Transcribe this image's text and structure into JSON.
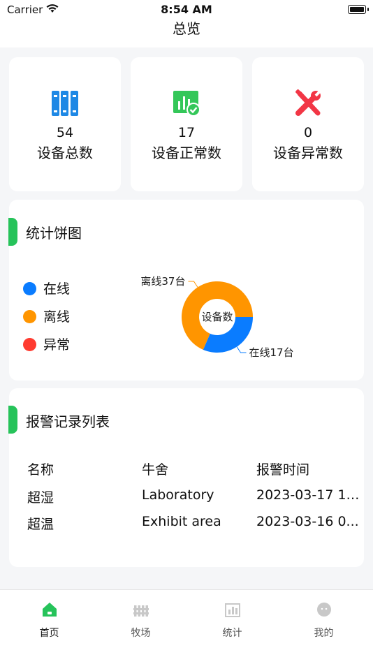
{
  "status_bar": {
    "carrier": "Carrier",
    "time": "8:54 AM"
  },
  "nav": {
    "title": "总览"
  },
  "stats": [
    {
      "value": "54",
      "label": "设备总数",
      "icon": "device-rack-icon",
      "color": "#1e88e5"
    },
    {
      "value": "17",
      "label": "设备正常数",
      "icon": "chart-check-icon",
      "color": "#34c759"
    },
    {
      "value": "0",
      "label": "设备异常数",
      "icon": "wrench-tools-icon",
      "color": "#f23645"
    }
  ],
  "pie_section": {
    "title": "统计饼图"
  },
  "chart_data": {
    "type": "pie",
    "center_label": "设备数",
    "legend": [
      {
        "name": "在线",
        "color": "#0a7cff"
      },
      {
        "name": "离线",
        "color": "#ff9500"
      },
      {
        "name": "异常",
        "color": "#ff3b30"
      }
    ],
    "slices": [
      {
        "name": "在线",
        "value": 17,
        "color": "#0a7cff",
        "label": "在线17台"
      },
      {
        "name": "离线",
        "value": 37,
        "color": "#ff9500",
        "label": "离线37台"
      },
      {
        "name": "异常",
        "value": 0,
        "color": "#ff3b30"
      }
    ]
  },
  "alarm_section": {
    "title": "报警记录列表",
    "headers": [
      "名称",
      "牛舍",
      "报警时间"
    ],
    "rows": [
      [
        "超湿",
        "Laboratory",
        "2023-03-17 11..."
      ],
      [
        "超温",
        "Exhibit area",
        "2023-03-16 0..."
      ]
    ]
  },
  "tabs": [
    {
      "label": "首页",
      "icon": "home-icon",
      "active": true
    },
    {
      "label": "牧场",
      "icon": "fence-icon",
      "active": false
    },
    {
      "label": "统计",
      "icon": "bar-chart-icon",
      "active": false
    },
    {
      "label": "我的",
      "icon": "user-face-icon",
      "active": false
    }
  ],
  "colors": {
    "accent": "#26c35a",
    "online": "#0a7cff",
    "offline": "#ff9500",
    "abnormal": "#ff3b30"
  }
}
